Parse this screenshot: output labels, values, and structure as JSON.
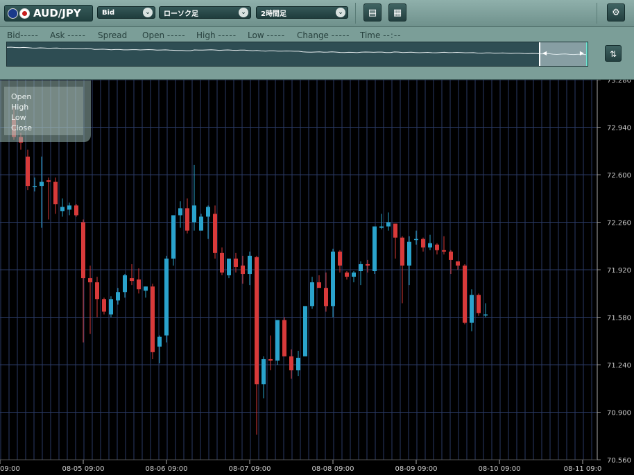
{
  "toolbar": {
    "pair": "AUD/JPY",
    "price_type": "Bid",
    "chart_type": "ローソク足",
    "timeframe": "2時間足",
    "icons": [
      "chart-window-icon",
      "layout-icon",
      "settings-gear-icon"
    ]
  },
  "quote": {
    "fields": [
      {
        "label": "Bid",
        "value": "-----"
      },
      {
        "label": "Ask",
        "value": "-----"
      },
      {
        "label": "Spread",
        "value": ""
      },
      {
        "label": "Open",
        "value": "-----"
      },
      {
        "label": "High",
        "value": "-----"
      },
      {
        "label": "Low",
        "value": "-----"
      },
      {
        "label": "Change",
        "value": "-----"
      },
      {
        "label": "Time",
        "value": "--:--"
      }
    ]
  },
  "ohlc_box": {
    "open": "Open",
    "high": "High",
    "low": "Low",
    "close": "Close"
  },
  "colors": {
    "up": "#2aa3cc",
    "down": "#d83a3a",
    "grid": "#2a3a66",
    "axis_text": "#cfcfcf"
  },
  "chart_data": {
    "type": "candlestick",
    "y_ticks": [
      "73.280",
      "72.940",
      "72.600",
      "72.260",
      "71.920",
      "71.580",
      "71.240",
      "70.900",
      "70.560"
    ],
    "ylim": [
      70.56,
      73.28
    ],
    "x_labels": [
      "09:00",
      "08-05 09:00",
      "08-06 09:00",
      "08-07 09:00",
      "08-08 09:00",
      "08-09 09:00",
      "08-10 09:00",
      "08-11 09:0"
    ],
    "candles": [
      [
        73.0,
        73.08,
        72.85,
        72.87
      ],
      [
        72.87,
        72.9,
        72.78,
        72.83
      ],
      [
        72.73,
        72.78,
        72.49,
        72.52
      ],
      [
        72.52,
        72.58,
        72.48,
        72.52
      ],
      [
        72.52,
        72.73,
        72.22,
        72.55
      ],
      [
        72.56,
        72.58,
        72.28,
        72.55
      ],
      [
        72.55,
        72.58,
        72.32,
        72.39
      ],
      [
        72.34,
        72.43,
        72.3,
        72.37
      ],
      [
        72.35,
        72.4,
        72.31,
        72.38
      ],
      [
        72.38,
        72.39,
        72.3,
        72.31
      ],
      [
        72.26,
        72.28,
        71.4,
        71.86
      ],
      [
        71.86,
        71.95,
        71.46,
        71.83
      ],
      [
        71.83,
        71.87,
        71.58,
        71.71
      ],
      [
        71.71,
        71.72,
        71.6,
        71.62
      ],
      [
        71.6,
        71.73,
        71.58,
        71.71
      ],
      [
        71.7,
        71.79,
        71.67,
        71.76
      ],
      [
        71.76,
        71.89,
        71.72,
        71.88
      ],
      [
        71.86,
        71.96,
        71.81,
        71.84
      ],
      [
        71.85,
        71.93,
        71.75,
        71.78
      ],
      [
        71.77,
        71.8,
        71.72,
        71.8
      ],
      [
        71.8,
        71.82,
        71.28,
        71.33
      ],
      [
        71.37,
        71.45,
        71.25,
        71.44
      ],
      [
        71.45,
        72.02,
        71.4,
        72.0
      ],
      [
        72.0,
        72.3,
        71.95,
        72.31
      ],
      [
        72.31,
        72.41,
        72.22,
        72.36
      ],
      [
        72.36,
        72.43,
        72.18,
        72.2
      ],
      [
        72.26,
        72.67,
        72.2,
        72.38
      ],
      [
        72.2,
        72.32,
        72.2,
        72.3
      ],
      [
        72.3,
        72.38,
        72.14,
        72.37
      ],
      [
        72.32,
        72.38,
        72.0,
        72.04
      ],
      [
        72.04,
        72.08,
        71.88,
        71.9
      ],
      [
        71.88,
        71.99,
        71.86,
        72.0
      ],
      [
        72.0,
        72.04,
        71.9,
        71.94
      ],
      [
        71.95,
        72.02,
        71.82,
        71.89
      ],
      [
        71.89,
        72.05,
        71.81,
        72.02
      ],
      [
        72.01,
        72.02,
        70.74,
        71.1
      ],
      [
        71.1,
        71.3,
        71.0,
        71.28
      ],
      [
        71.28,
        71.45,
        71.2,
        71.27
      ],
      [
        71.27,
        71.56,
        71.24,
        71.56
      ],
      [
        71.56,
        71.58,
        71.3,
        71.3
      ],
      [
        71.3,
        71.35,
        71.14,
        71.2
      ],
      [
        71.2,
        71.34,
        71.16,
        71.29
      ],
      [
        71.3,
        71.66,
        71.3,
        71.66
      ],
      [
        71.66,
        71.87,
        71.64,
        71.83
      ],
      [
        71.83,
        71.88,
        71.82,
        71.79
      ],
      [
        71.79,
        71.9,
        71.62,
        71.66
      ],
      [
        71.66,
        72.07,
        71.58,
        72.05
      ],
      [
        72.05,
        72.06,
        71.9,
        71.95
      ],
      [
        71.9,
        71.91,
        71.85,
        71.87
      ],
      [
        71.87,
        71.91,
        71.83,
        71.9
      ],
      [
        71.91,
        71.98,
        71.81,
        71.96
      ],
      [
        71.96,
        71.99,
        71.9,
        71.95
      ],
      [
        71.91,
        72.23,
        71.89,
        72.23
      ],
      [
        72.22,
        72.32,
        72.21,
        72.23
      ],
      [
        72.23,
        72.33,
        72.2,
        72.26
      ],
      [
        72.25,
        72.25,
        72.0,
        72.15
      ],
      [
        72.15,
        72.16,
        71.68,
        71.95
      ],
      [
        71.95,
        72.16,
        71.81,
        72.12
      ],
      [
        72.14,
        72.2,
        72.1,
        72.14
      ],
      [
        72.14,
        72.15,
        72.05,
        72.08
      ],
      [
        72.08,
        72.17,
        72.06,
        72.11
      ],
      [
        72.1,
        72.11,
        72.03,
        72.06
      ],
      [
        72.06,
        72.16,
        72.03,
        72.05
      ],
      [
        72.05,
        72.06,
        71.89,
        71.99
      ],
      [
        71.98,
        71.98,
        71.92,
        71.95
      ],
      [
        71.95,
        71.96,
        71.53,
        71.54
      ],
      [
        71.54,
        71.78,
        71.48,
        71.74
      ],
      [
        71.74,
        71.75,
        71.59,
        71.61
      ],
      [
        71.6,
        71.68,
        71.58,
        71.6
      ]
    ]
  }
}
